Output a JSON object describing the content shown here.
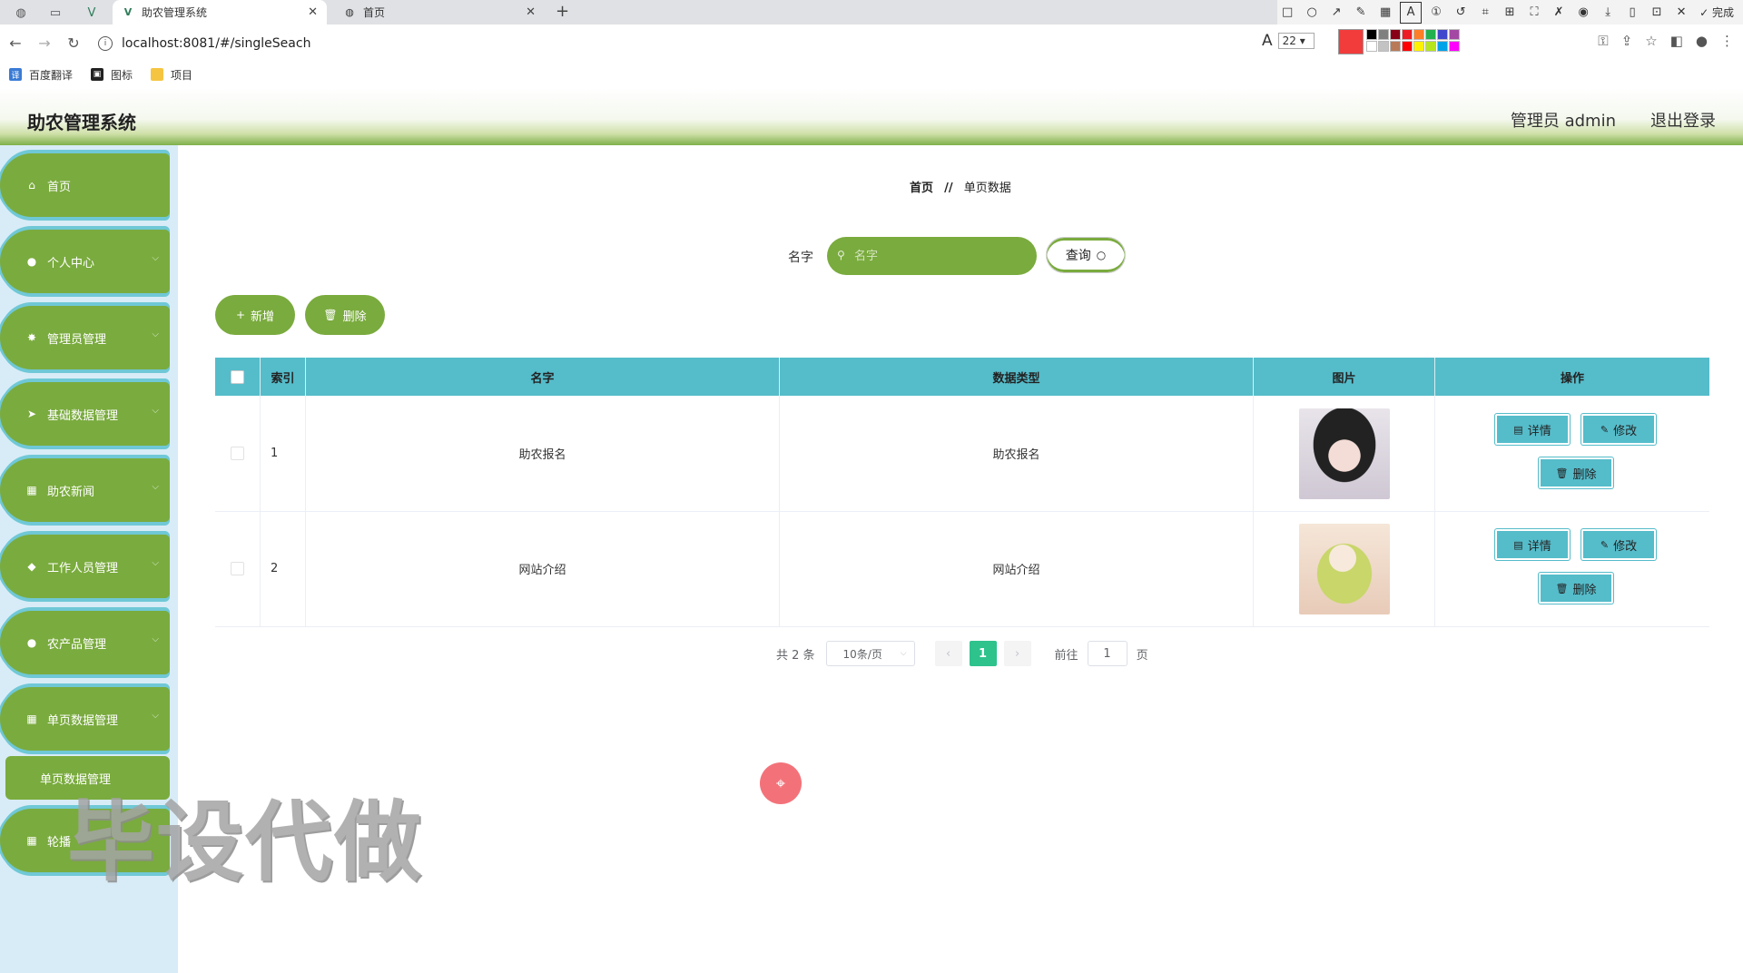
{
  "browser": {
    "tabs": [
      {
        "title": "助农管理系统",
        "active": true
      },
      {
        "title": "首页",
        "active": false
      }
    ],
    "url": "localhost:8081/#/singleSeach",
    "font_size_value": "22",
    "toolbar_done": "完成",
    "bookmarks": [
      "百度翻译",
      "图标",
      "项目"
    ],
    "palette": [
      "#000000",
      "#7f7f7f",
      "#880015",
      "#ed1c24",
      "#ff7f27",
      "#22b14c",
      "#3f48cc",
      "#a349a4",
      "#ffffff",
      "#c3c3c3",
      "#b97a57",
      "#ff0000",
      "#fff200",
      "#b5e61d",
      "#00a2e8",
      "#ff00ff"
    ]
  },
  "header": {
    "title": "助农管理系统",
    "user": "管理员 admin",
    "logout": "退出登录"
  },
  "sidebar": {
    "items": [
      {
        "label": "首页",
        "icon": "home-icon"
      },
      {
        "label": "个人中心",
        "icon": "user-icon"
      },
      {
        "label": "管理员管理",
        "icon": "admin-icon"
      },
      {
        "label": "基础数据管理",
        "icon": "send-icon"
      },
      {
        "label": "助农新闻",
        "icon": "grid-icon"
      },
      {
        "label": "工作人员管理",
        "icon": "location-icon"
      },
      {
        "label": "农产品管理",
        "icon": "user-icon"
      },
      {
        "label": "单页数据管理",
        "icon": "grid-icon"
      },
      {
        "label": "轮播",
        "icon": "grid-icon"
      }
    ],
    "subitem": "单页数据管理"
  },
  "breadcrumb": {
    "home": "首页",
    "sep": "//",
    "current": "单页数据"
  },
  "search": {
    "label": "名字",
    "placeholder": "名字",
    "button": "查询"
  },
  "actions": {
    "add": "新增",
    "delete": "删除"
  },
  "table": {
    "headers": [
      "索引",
      "名字",
      "数据类型",
      "图片",
      "操作"
    ],
    "rows": [
      {
        "index": "1",
        "name": "助农报名",
        "type": "助农报名"
      },
      {
        "index": "2",
        "name": "网站介绍",
        "type": "网站介绍"
      }
    ],
    "buttons": {
      "detail": "详情",
      "edit": "修改",
      "delete": "删除"
    }
  },
  "pagination": {
    "total": "共 2 条",
    "page_size": "10条/页",
    "current": "1",
    "goto_label": "前往",
    "goto_value": "1",
    "page_suffix": "页"
  },
  "watermark": "毕设代做"
}
